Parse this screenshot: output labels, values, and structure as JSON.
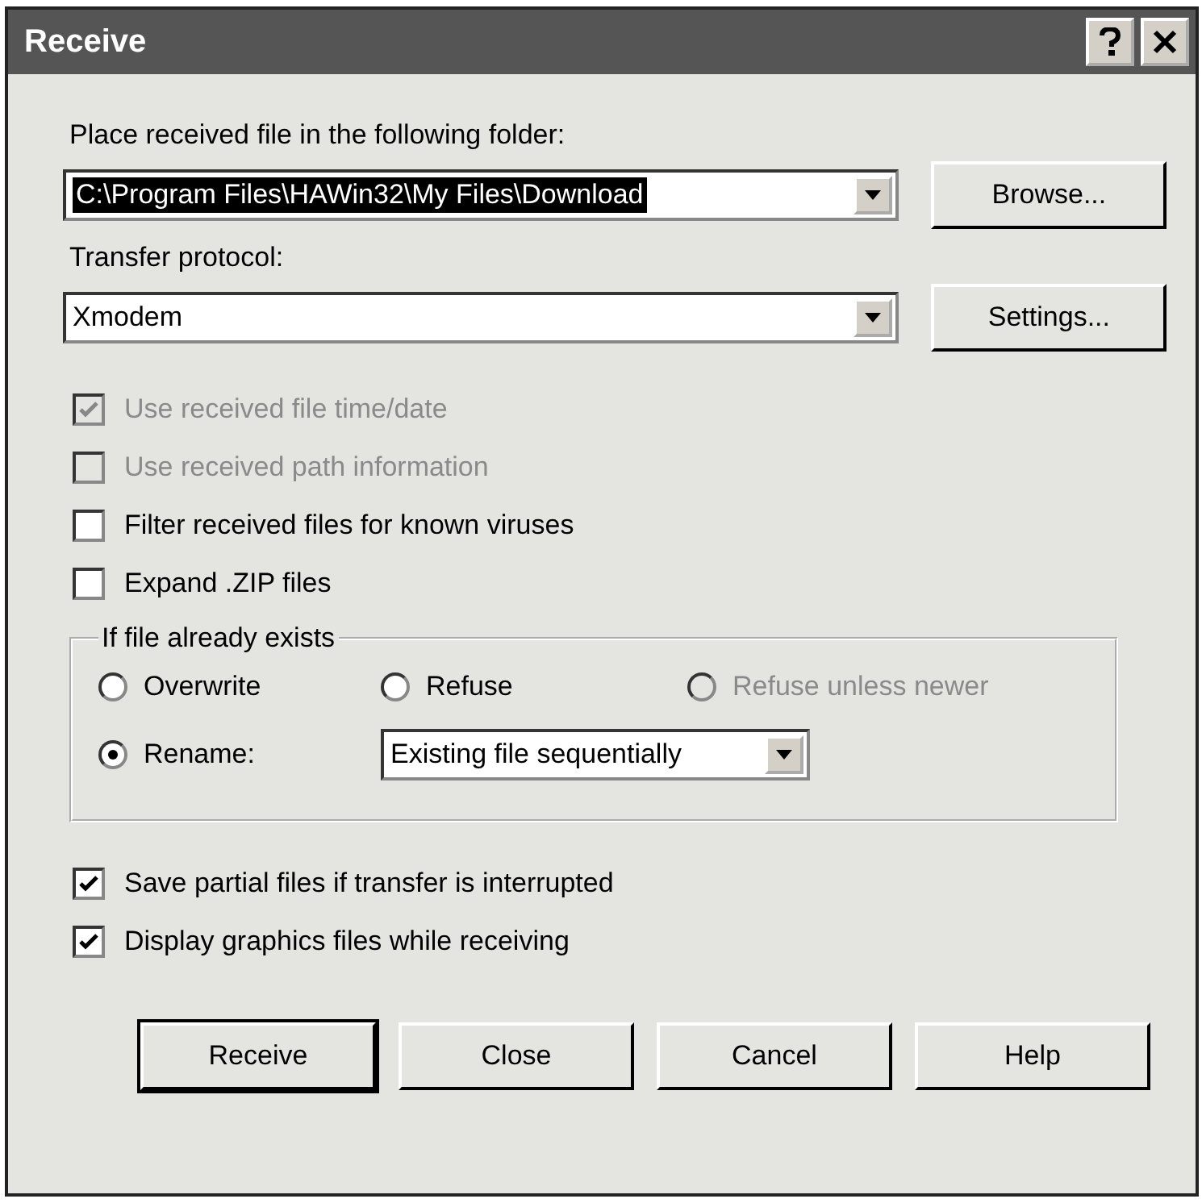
{
  "window": {
    "title": "Receive"
  },
  "folder": {
    "label": "Place received file in the following folder:",
    "value": "C:\\Program Files\\HAWin32\\My Files\\Download",
    "highlighted": true
  },
  "browse_button": "Browse...",
  "protocol": {
    "label": "Transfer protocol:",
    "value": "Xmodem",
    "highlighted": false
  },
  "settings_button": "Settings...",
  "options": [
    {
      "label": "Use received file time/date",
      "checked": true,
      "disabled": true
    },
    {
      "label": "Use received path information",
      "checked": false,
      "disabled": true
    },
    {
      "label": "Filter received files for known viruses",
      "checked": false,
      "disabled": false
    },
    {
      "label": "Expand .ZIP files",
      "checked": false,
      "disabled": false
    }
  ],
  "group": {
    "title": "If file already exists",
    "choices": [
      {
        "label": "Overwrite",
        "selected": false,
        "disabled": false
      },
      {
        "label": "Refuse",
        "selected": false,
        "disabled": false
      },
      {
        "label": "Refuse unless newer",
        "selected": false,
        "disabled": true
      },
      {
        "label": "Rename:",
        "selected": true,
        "disabled": false
      }
    ],
    "rename_mode": "Existing file sequentially"
  },
  "options_after": [
    {
      "label": "Save partial files if transfer is interrupted",
      "checked": true,
      "disabled": false
    },
    {
      "label": "Display graphics files while receiving",
      "checked": true,
      "disabled": false
    }
  ],
  "buttons": [
    {
      "label": "Receive",
      "default": true
    },
    {
      "label": "Close",
      "default": false
    },
    {
      "label": "Cancel",
      "default": false
    },
    {
      "label": "Help",
      "default": false
    }
  ]
}
